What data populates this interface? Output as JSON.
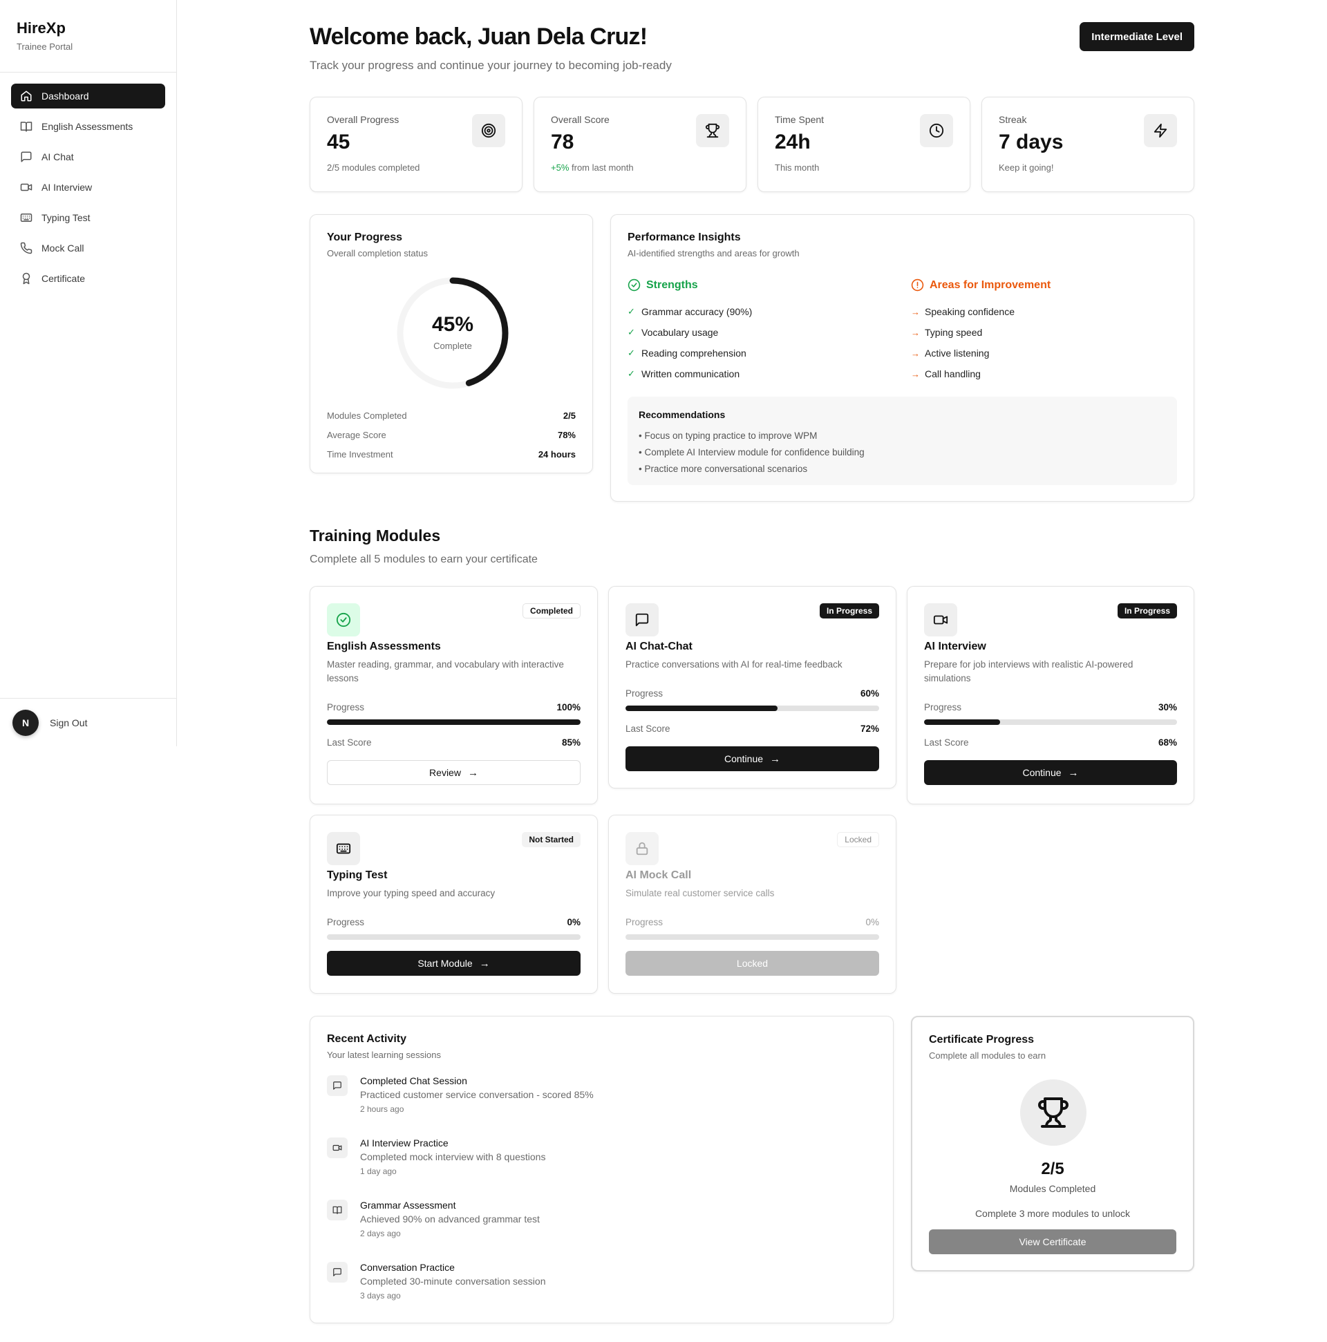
{
  "app": {
    "name": "HireXp",
    "subtitle": "Trainee Portal"
  },
  "sidebar": {
    "items": [
      {
        "label": "Dashboard",
        "icon": "home-icon",
        "active": true
      },
      {
        "label": "English Assessments",
        "icon": "book-icon"
      },
      {
        "label": "AI Chat",
        "icon": "chat-icon"
      },
      {
        "label": "AI Interview",
        "icon": "video-icon"
      },
      {
        "label": "Typing Test",
        "icon": "keyboard-icon"
      },
      {
        "label": "Mock Call",
        "icon": "phone-icon"
      },
      {
        "label": "Certificate",
        "icon": "award-icon"
      }
    ],
    "avatar_initial": "N",
    "signout": "Sign Out"
  },
  "header": {
    "title": "Welcome back, Juan Dela Cruz!",
    "subtitle": "Track your progress and continue your journey to becoming job-ready",
    "level": "Intermediate Level"
  },
  "stats": [
    {
      "label": "Overall Progress",
      "value": "45",
      "note": "2/5 modules completed",
      "icon": "target-icon"
    },
    {
      "label": "Overall Score",
      "value": "78",
      "note_highlight": "+5%",
      "note": " from last month",
      "icon": "trophy-icon"
    },
    {
      "label": "Time Spent",
      "value": "24h",
      "note": "This month",
      "icon": "clock-icon"
    },
    {
      "label": "Streak",
      "value": "7 days",
      "note": "Keep it going!",
      "icon": "zap-icon"
    }
  ],
  "progress": {
    "title": "Your Progress",
    "subtitle": "Overall completion status",
    "percent_label": "45%",
    "percent": 45,
    "complete_label": "Complete",
    "rows": [
      {
        "k": "Modules Completed",
        "v": "2/5"
      },
      {
        "k": "Average Score",
        "v": "78%"
      },
      {
        "k": "Time Investment",
        "v": "24 hours"
      }
    ]
  },
  "insights": {
    "title": "Performance Insights",
    "subtitle": "AI-identified strengths and areas for growth",
    "strengths_title": "Strengths",
    "strengths": [
      "Grammar accuracy (90%)",
      "Vocabulary usage",
      "Reading comprehension",
      "Written communication"
    ],
    "improve_title": "Areas for Improvement",
    "improve": [
      "Speaking confidence",
      "Typing speed",
      "Active listening",
      "Call handling"
    ],
    "recs_title": "Recommendations",
    "recs": [
      "• Focus on typing practice to improve WPM",
      "• Complete AI Interview module for confidence building",
      "• Practice more conversational scenarios"
    ],
    "colors": {
      "green": "#16a34a",
      "orange": "#ea580c"
    }
  },
  "training": {
    "title": "Training Modules",
    "subtitle": "Complete all 5 modules to earn your certificate",
    "modules": [
      {
        "title": "English Assessments",
        "desc": "Master reading, grammar, and vocabulary with interactive lessons",
        "badge": "Completed",
        "progress_label": "Progress",
        "progress": "100%",
        "progress_value": 100,
        "score_label": "Last Score",
        "score": "85%",
        "button": "Review",
        "icon": "check-circle-icon"
      },
      {
        "title": "AI Chat-Chat",
        "desc": "Practice conversations with AI for real-time feedback",
        "badge": "In Progress",
        "progress_label": "Progress",
        "progress": "60%",
        "progress_value": 60,
        "score_label": "Last Score",
        "score": "72%",
        "button": "Continue",
        "icon": "chat-icon"
      },
      {
        "title": "AI Interview",
        "desc": "Prepare for job interviews with realistic AI-powered simulations",
        "badge": "In Progress",
        "progress_label": "Progress",
        "progress": "30%",
        "progress_value": 30,
        "score_label": "Last Score",
        "score": "68%",
        "button": "Continue",
        "icon": "video-icon"
      },
      {
        "title": "Typing Test",
        "desc": "Improve your typing speed and accuracy",
        "badge": "Not Started",
        "progress_label": "Progress",
        "progress": "0%",
        "progress_value": 0,
        "button": "Start Module",
        "icon": "keyboard-icon"
      },
      {
        "title": "AI Mock Call",
        "desc": "Simulate real customer service calls",
        "badge": "Locked",
        "progress_label": "Progress",
        "progress": "0%",
        "progress_value": 0,
        "button": "Locked",
        "icon": "lock-icon"
      }
    ]
  },
  "activity": {
    "title": "Recent Activity",
    "subtitle": "Your latest learning sessions",
    "items": [
      {
        "title": "Completed Chat Session",
        "desc": "Practiced customer service conversation - scored 85%",
        "time": "2 hours ago",
        "icon": "chat-icon"
      },
      {
        "title": "AI Interview Practice",
        "desc": "Completed mock interview with 8 questions",
        "time": "1 day ago",
        "icon": "video-icon"
      },
      {
        "title": "Grammar Assessment",
        "desc": "Achieved 90% on advanced grammar test",
        "time": "2 days ago",
        "icon": "book-icon"
      },
      {
        "title": "Conversation Practice",
        "desc": "Completed 30-minute conversation session",
        "time": "3 days ago",
        "icon": "chat-icon"
      }
    ]
  },
  "certificate": {
    "title": "Certificate Progress",
    "subtitle": "Complete all modules to earn",
    "count": "2/5",
    "count_label": "Modules Completed",
    "note": "Complete 3 more modules to unlock",
    "button": "View Certificate"
  }
}
